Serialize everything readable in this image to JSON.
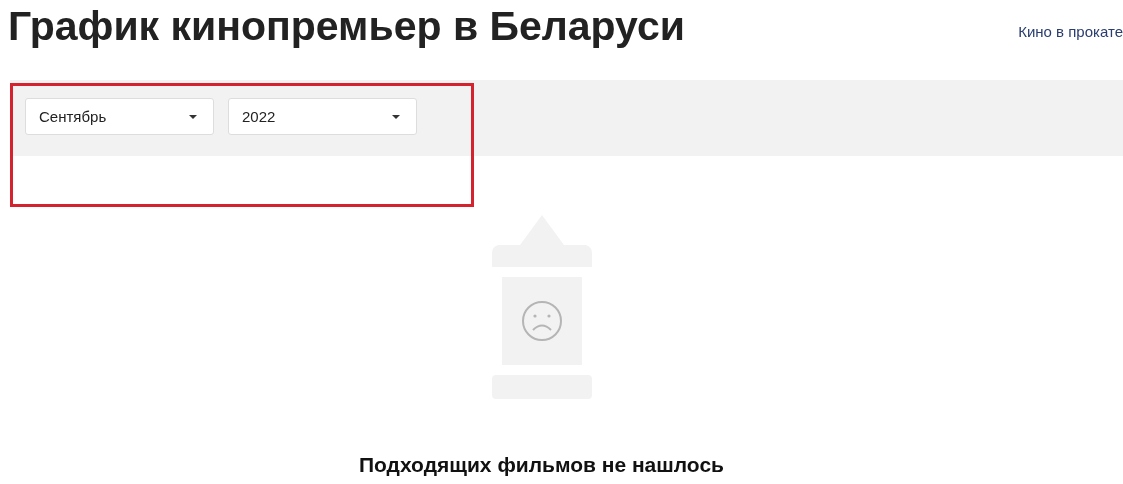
{
  "page": {
    "title": "График кинопремьер в Беларуси",
    "link": "Кино в прокате"
  },
  "filters": [
    {
      "value": "Сентябрь"
    },
    {
      "value": "2022"
    }
  ],
  "empty_state": {
    "message": "Подходящих фильмов не нашлось"
  }
}
